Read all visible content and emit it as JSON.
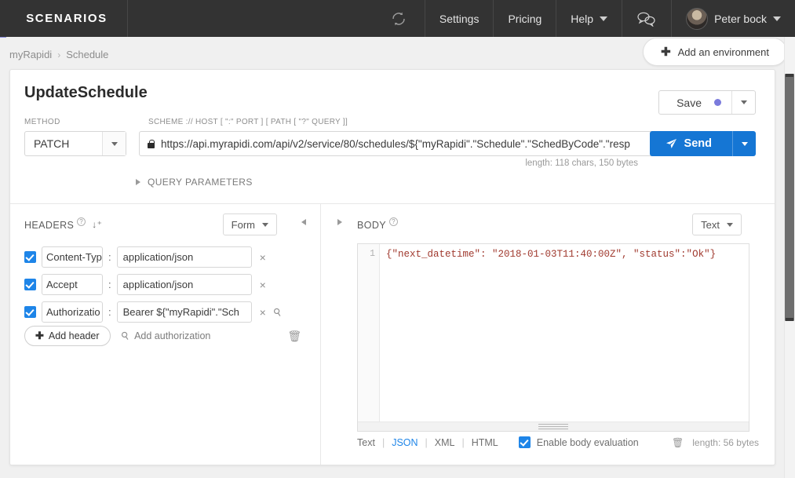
{
  "navbar": {
    "brand": "SCENARIOS",
    "refresh_icon": "refresh-icon",
    "items": [
      {
        "label": "Settings",
        "name": "settings"
      },
      {
        "label": "Pricing",
        "name": "pricing"
      },
      {
        "label": "Help",
        "name": "help",
        "caret": true
      }
    ],
    "chat_icon": "chat-bubbles-icon",
    "user_name": "Peter bock"
  },
  "breadcrumb": {
    "root": "myRapidi",
    "separator": "›",
    "current": "Schedule"
  },
  "environment": {
    "plus": "✚",
    "label": "Add an environment"
  },
  "request": {
    "title": "UpdateSchedule",
    "save_label": "Save",
    "save_dot_color": "#7b7bdc",
    "method_label": "METHOD",
    "method_value": "PATCH",
    "scheme_label": "SCHEME :// HOST [ \":\" PORT ] [ PATH [ \"?\" QUERY ]]",
    "url_value": "https://api.myrapidi.com/api/v2/service/80/schedules/${\"myRapidi\".\"Schedule\".\"SchedByCode\".\"resp",
    "send_label": "Send",
    "send_icon": "paper-plane-icon",
    "send_color": "#1576d4",
    "url_length": "length: 118 chars, 150 bytes",
    "query_params_label": "QUERY PARAMETERS"
  },
  "headers": {
    "title": "HEADERS",
    "help_icon": "?",
    "sort_icon": "↓ᴀ₂",
    "sort_glyph": "⇣",
    "format_select": "Form",
    "rows": [
      {
        "checked": true,
        "key": "Content-Typ",
        "value": "application/json",
        "has_key_icon": false
      },
      {
        "checked": true,
        "key": "Accept",
        "value": "application/json",
        "has_key_icon": false
      },
      {
        "checked": true,
        "key": "Authorizatio",
        "value": "Bearer ${\"myRapidi\".\"Sch",
        "has_key_icon": true
      }
    ],
    "colon": ":",
    "remove_icon": "×",
    "add_header_label": "Add header",
    "add_authorization_label": "Add authorization",
    "trash_icon": "🗑"
  },
  "body": {
    "title": "BODY",
    "help_icon": "?",
    "format_select": "Text",
    "line_number": "1",
    "content": "{\"next_datetime\": \"2018-01-03T11:40:00Z\", \"status\":\"Ok\"}",
    "content_color": "#a0392e",
    "formats": [
      {
        "label": "Text",
        "active": false
      },
      {
        "label": "JSON",
        "active": true
      },
      {
        "label": "XML",
        "active": false
      },
      {
        "label": "HTML",
        "active": false
      }
    ],
    "eval_label": "Enable body evaluation",
    "eval_checked": true,
    "trash_icon": "🗑",
    "length": "length: 56 bytes"
  }
}
